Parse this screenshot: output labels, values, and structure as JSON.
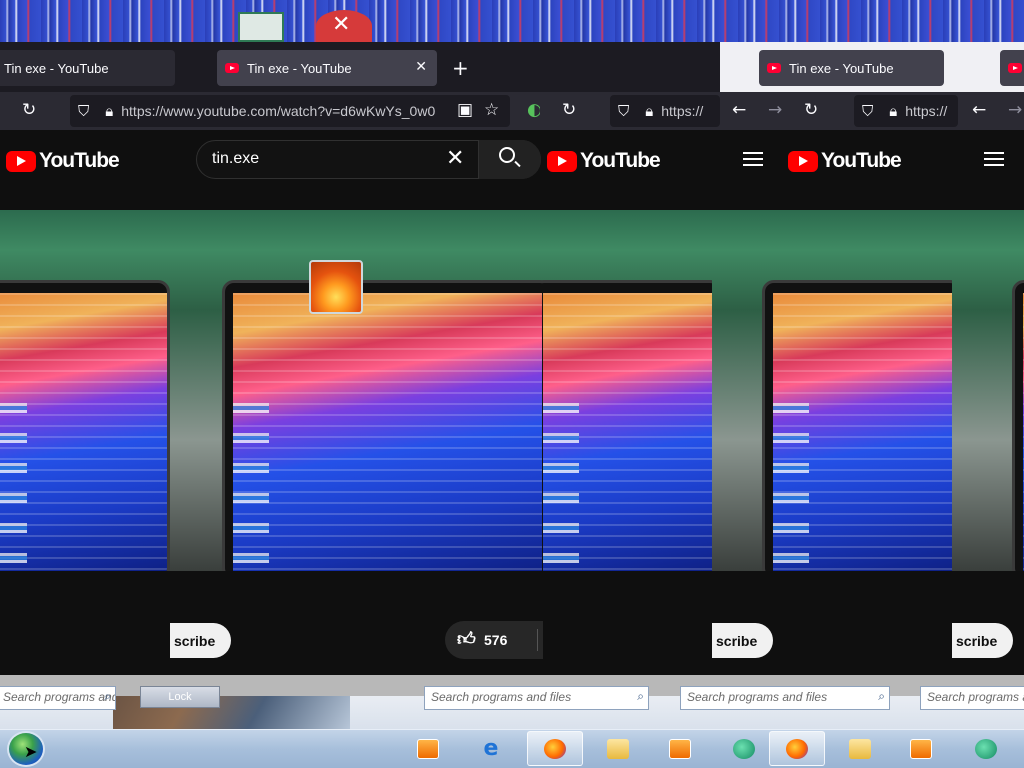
{
  "tabs": [
    {
      "title": "Tin exe - YouTube"
    },
    {
      "title": "Tin exe - YouTube"
    },
    {
      "title": "Tin exe - YouTube"
    }
  ],
  "address_bar": {
    "url": "https://www.youtube.com/watch?v=d6wKwYs_0w0",
    "url_partial_1": "https://",
    "url_partial_2": "https://"
  },
  "youtube": {
    "logo_text": "YouTube",
    "search_value": "tin.exe",
    "subscribe_label": "scribe",
    "like_count": "576"
  },
  "start_menu": {
    "search_placeholder": "Search programs and files",
    "lock_label": "Lock"
  },
  "taskbar": {
    "items": [
      "windows-media-player",
      "internet-explorer",
      "firefox",
      "explorer",
      "windows-media-player",
      "windows-live-messenger",
      "firefox",
      "explorer",
      "windows-media-player",
      "windows-live-messenger"
    ]
  },
  "colors": {
    "youtube_red": "#ff0000",
    "firefox_tab": "#42414d",
    "taskbar": "#a7bfdb"
  }
}
